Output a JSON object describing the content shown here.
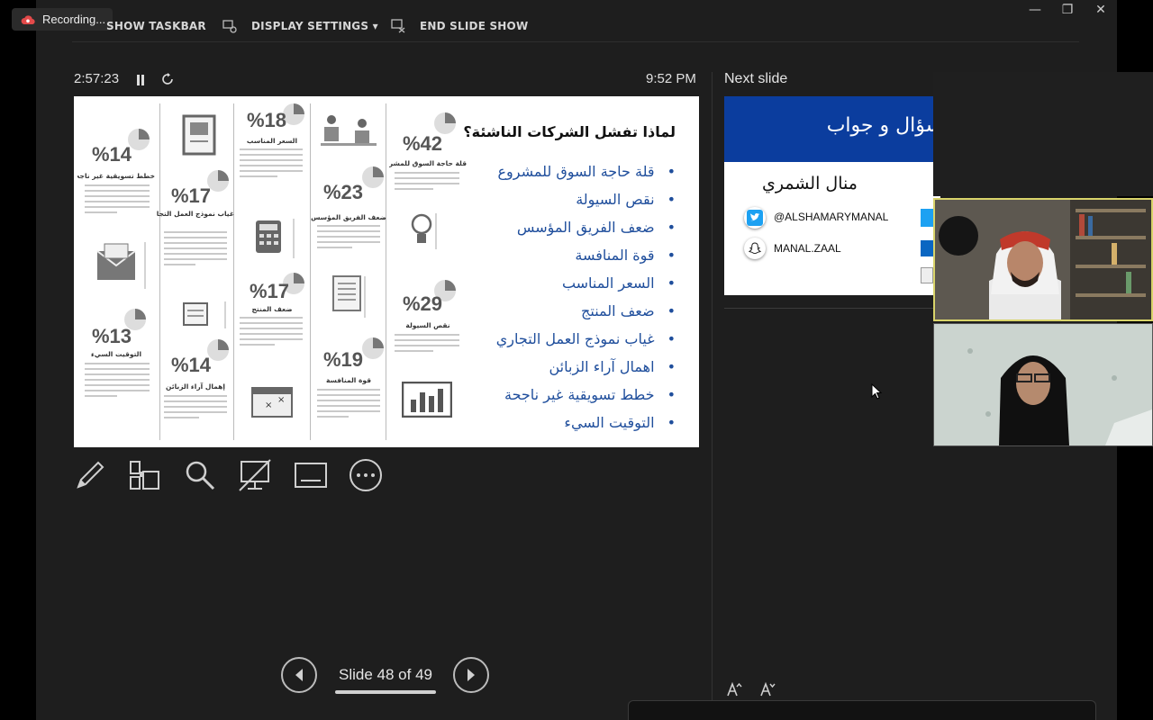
{
  "recording": {
    "label": "Recording..."
  },
  "toolbar": {
    "show_taskbar": "SHOW TASKBAR",
    "display_settings": "DISPLAY SETTINGS ▾",
    "end_slide_show": "END SLIDE SHOW"
  },
  "timer": {
    "elapsed": "2:57:23",
    "clock": "9:52 PM"
  },
  "slide": {
    "title": "لماذا تفشل الشركات الناشئة؟",
    "bullets": [
      "قلة حاجة السوق للمشروع",
      "نقص السيولة",
      "ضعف الفريق المؤسس",
      "قوة المنافسة",
      "السعر المناسب",
      "ضعف المنتج",
      "غياب نموذج العمل التجاري",
      "اهمال آراء الزبائن",
      "خطط تسويقية غير ناجحة",
      "التوقيت السيء"
    ],
    "stats": [
      {
        "value": "%42",
        "label": "قلة حاجة السوق للمشروع"
      },
      {
        "value": "%29",
        "label": "نقص السيولة"
      },
      {
        "value": "%23",
        "label": "ضعف الفريق المؤسس"
      },
      {
        "value": "%19",
        "label": "قوة المنافسة"
      },
      {
        "value": "%18",
        "label": "السعر المناسب"
      },
      {
        "value": "%17",
        "label": "ضعف المنتج"
      },
      {
        "value": "%17",
        "label": "غياب نموذج العمل التجاري"
      },
      {
        "value": "%14",
        "label": "إهمال آراء الزبائن"
      },
      {
        "value": "%14",
        "label": "خطط تسويقية غير ناجحة"
      },
      {
        "value": "%13",
        "label": "التوقيت السيء"
      }
    ]
  },
  "navigation": {
    "counter": "Slide 48 of 49"
  },
  "next_slide": {
    "label": "Next slide",
    "title": "سؤال و جواب",
    "name": "منال الشمري",
    "twitter_handle": "@ALSHAMARYMANAL",
    "snapchat_handle": "MANAL.ZAAL"
  },
  "colors": {
    "background": "#1e1e1e",
    "slide_bullet_blue": "#1f4e9c",
    "next_slide_header": "#0b3d9e",
    "active_speaker_border": "#d8d36a"
  },
  "icons": [
    "pen-icon",
    "all-slides-icon",
    "zoom-icon",
    "black-screen-icon",
    "subtitles-icon",
    "more-options-icon",
    "previous-icon",
    "next-icon",
    "pause-icon",
    "restart-icon"
  ]
}
